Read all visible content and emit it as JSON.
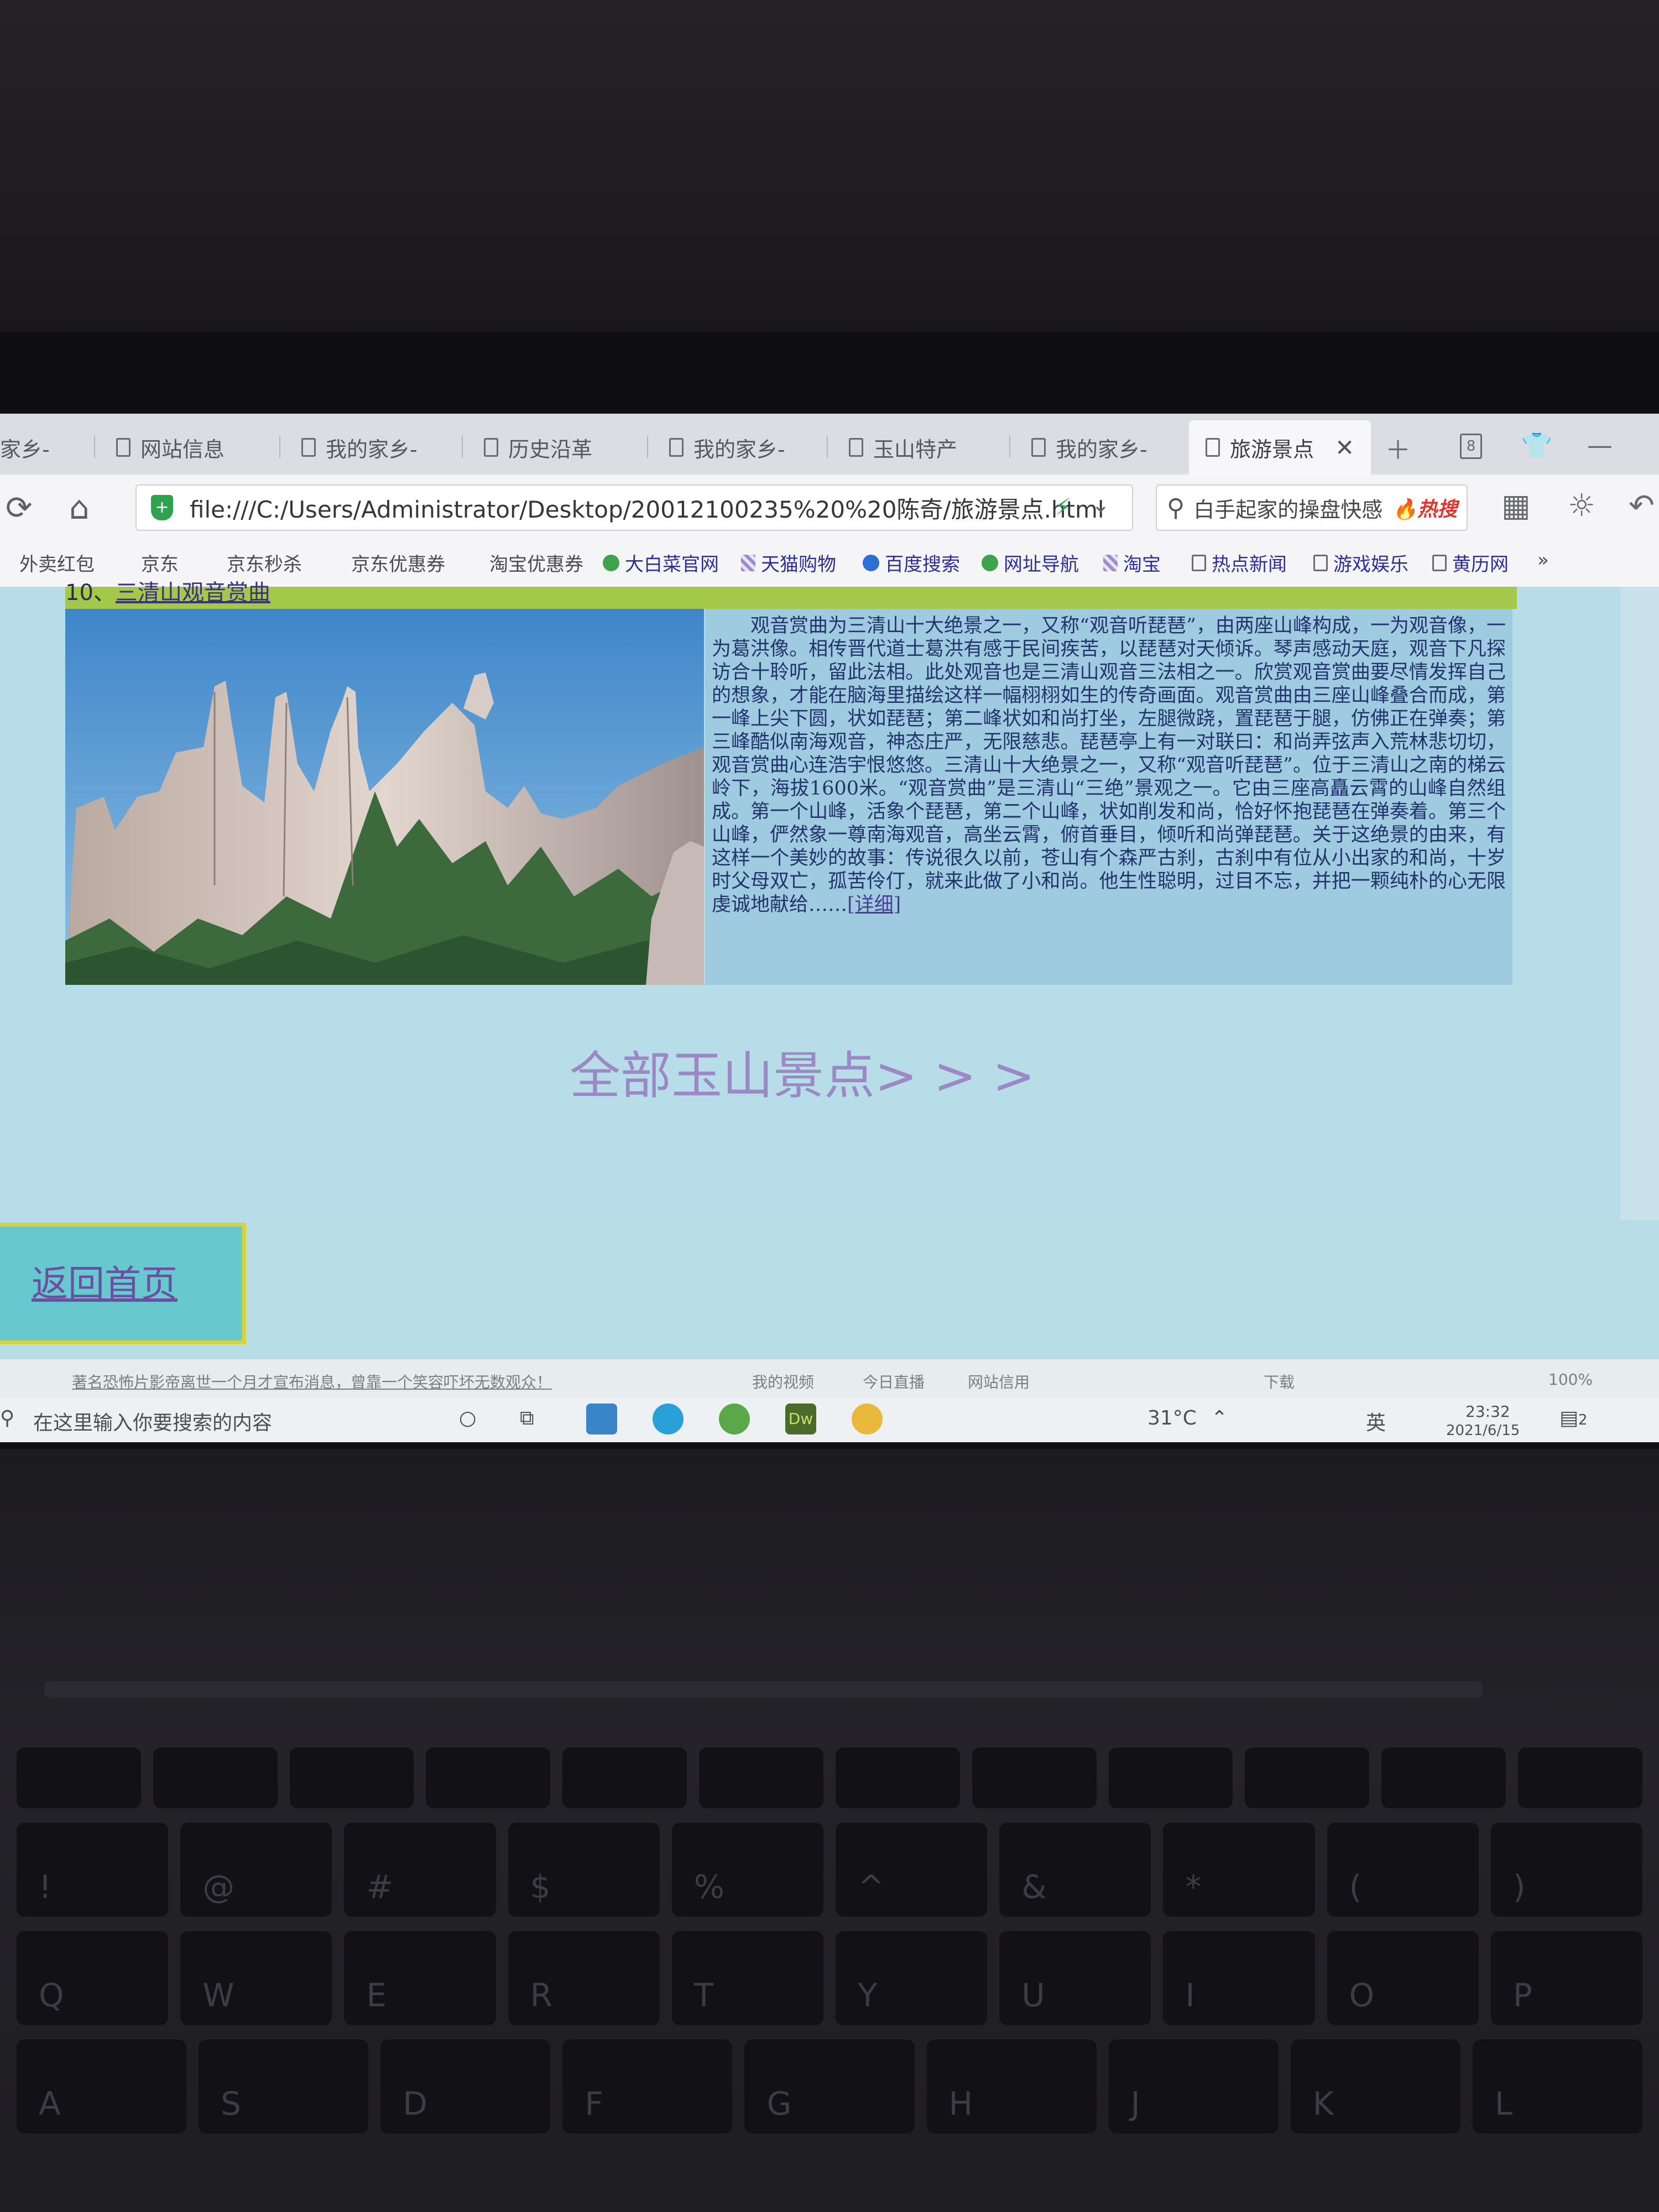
{
  "browser": {
    "tabs": [
      {
        "label": "家乡-"
      },
      {
        "label": "网站信息"
      },
      {
        "label": "我的家乡-"
      },
      {
        "label": "历史沿革"
      },
      {
        "label": "我的家乡-"
      },
      {
        "label": "玉山特产"
      },
      {
        "label": "我的家乡-"
      },
      {
        "label": "旅游景点",
        "active": true
      }
    ],
    "tab_count": "8",
    "url": "file:///C:/Users/Administrator/Desktop/20012100235%20%20陈奇/旅游景点.html",
    "search_text": "白手起家的操盘快感",
    "search_badge": "热搜",
    "bookmarks": [
      "外卖红包",
      "京东",
      "京东秒杀",
      "京东优惠券",
      "淘宝优惠券",
      "大白菜官网",
      "天猫购物",
      "百度搜索",
      "网址导航",
      "淘宝",
      "热点新闻",
      "游戏娱乐",
      "黄历网",
      "»"
    ]
  },
  "page": {
    "heading_num": "10、",
    "heading_link": "三清山观音赏曲",
    "description": "观音赏曲为三清山十大绝景之一，又称“观音听琵琶”，由两座山峰构成，一为观音像，一为葛洪像。相传晋代道士葛洪有感于民间疾苦，以琵琶对天倾诉。琴声感动天庭，观音下凡探访合十聆听，留此法相。此处观音也是三清山观音三法相之一。欣赏观音赏曲要尽情发挥自己的想象，才能在脑海里描绘这样一幅栩栩如生的传奇画面。观音赏曲由三座山峰叠合而成，第一峰上尖下圆，状如琵琶；第二峰状如和尚打坐，左腿微跷，置琵琶于腿，仿佛正在弹奏；第三峰酷似南海观音，神态庄严，无限慈悲。琵琶亭上有一对联曰：和尚弄弦声入荒林悲切切，观音赏曲心连浩宇恨悠悠。三清山十大绝景之一，又称“观音听琵琶”。位于三清山之南的梯云岭下，海拔1600米。“观音赏曲”是三清山“三绝”景观之一。它由三座高矗云霄的山峰自然组成。第一个山峰，活象个琵琶，第二个山峰，状如削发和尚，恰好怀抱琵琶在弹奏着。第三个山峰，俨然象一尊南海观音，高坐云霄，俯首垂目，倾听和尚弹琵琶。关于这绝景的由来，有这样一个美妙的故事：传说很久以前，苍山有个森严古刹，古刹中有位从小出家的和尚，十岁时父母双亡，孤苦伶仃，就来此做了小和尚。他生性聪明，过目不忘，并把一颗纯朴的心无限虔诚地献给……",
    "more_link": "[详细]",
    "all_spots": "全部玉山景点> > >",
    "back_home": "返回首页"
  },
  "status_bar": {
    "news": "著名恐怖片影帝离世一个月才宣布消息，曾靠一个笑容吓坏无数观众！",
    "items": [
      "我的视频",
      "今日直播",
      "网站信用",
      "下载",
      "100%"
    ]
  },
  "taskbar": {
    "search_placeholder": "在这里输入你要搜索的内容",
    "temperature": "31°C",
    "ime": "英",
    "time": "23:32",
    "date": "2021/6/15",
    "notify_count": "2",
    "dw_label": "Dw"
  },
  "keyboard": {
    "row_digits": [
      "!",
      "@",
      "#",
      "$",
      "%",
      "^",
      "&",
      "*",
      "(",
      ")"
    ],
    "row_q": [
      "Q",
      "W",
      "E",
      "R",
      "T",
      "Y",
      "U",
      "I",
      "O",
      "P"
    ],
    "row_a": [
      "A",
      "S",
      "D",
      "F",
      "G",
      "H",
      "J",
      "K",
      "L"
    ]
  }
}
